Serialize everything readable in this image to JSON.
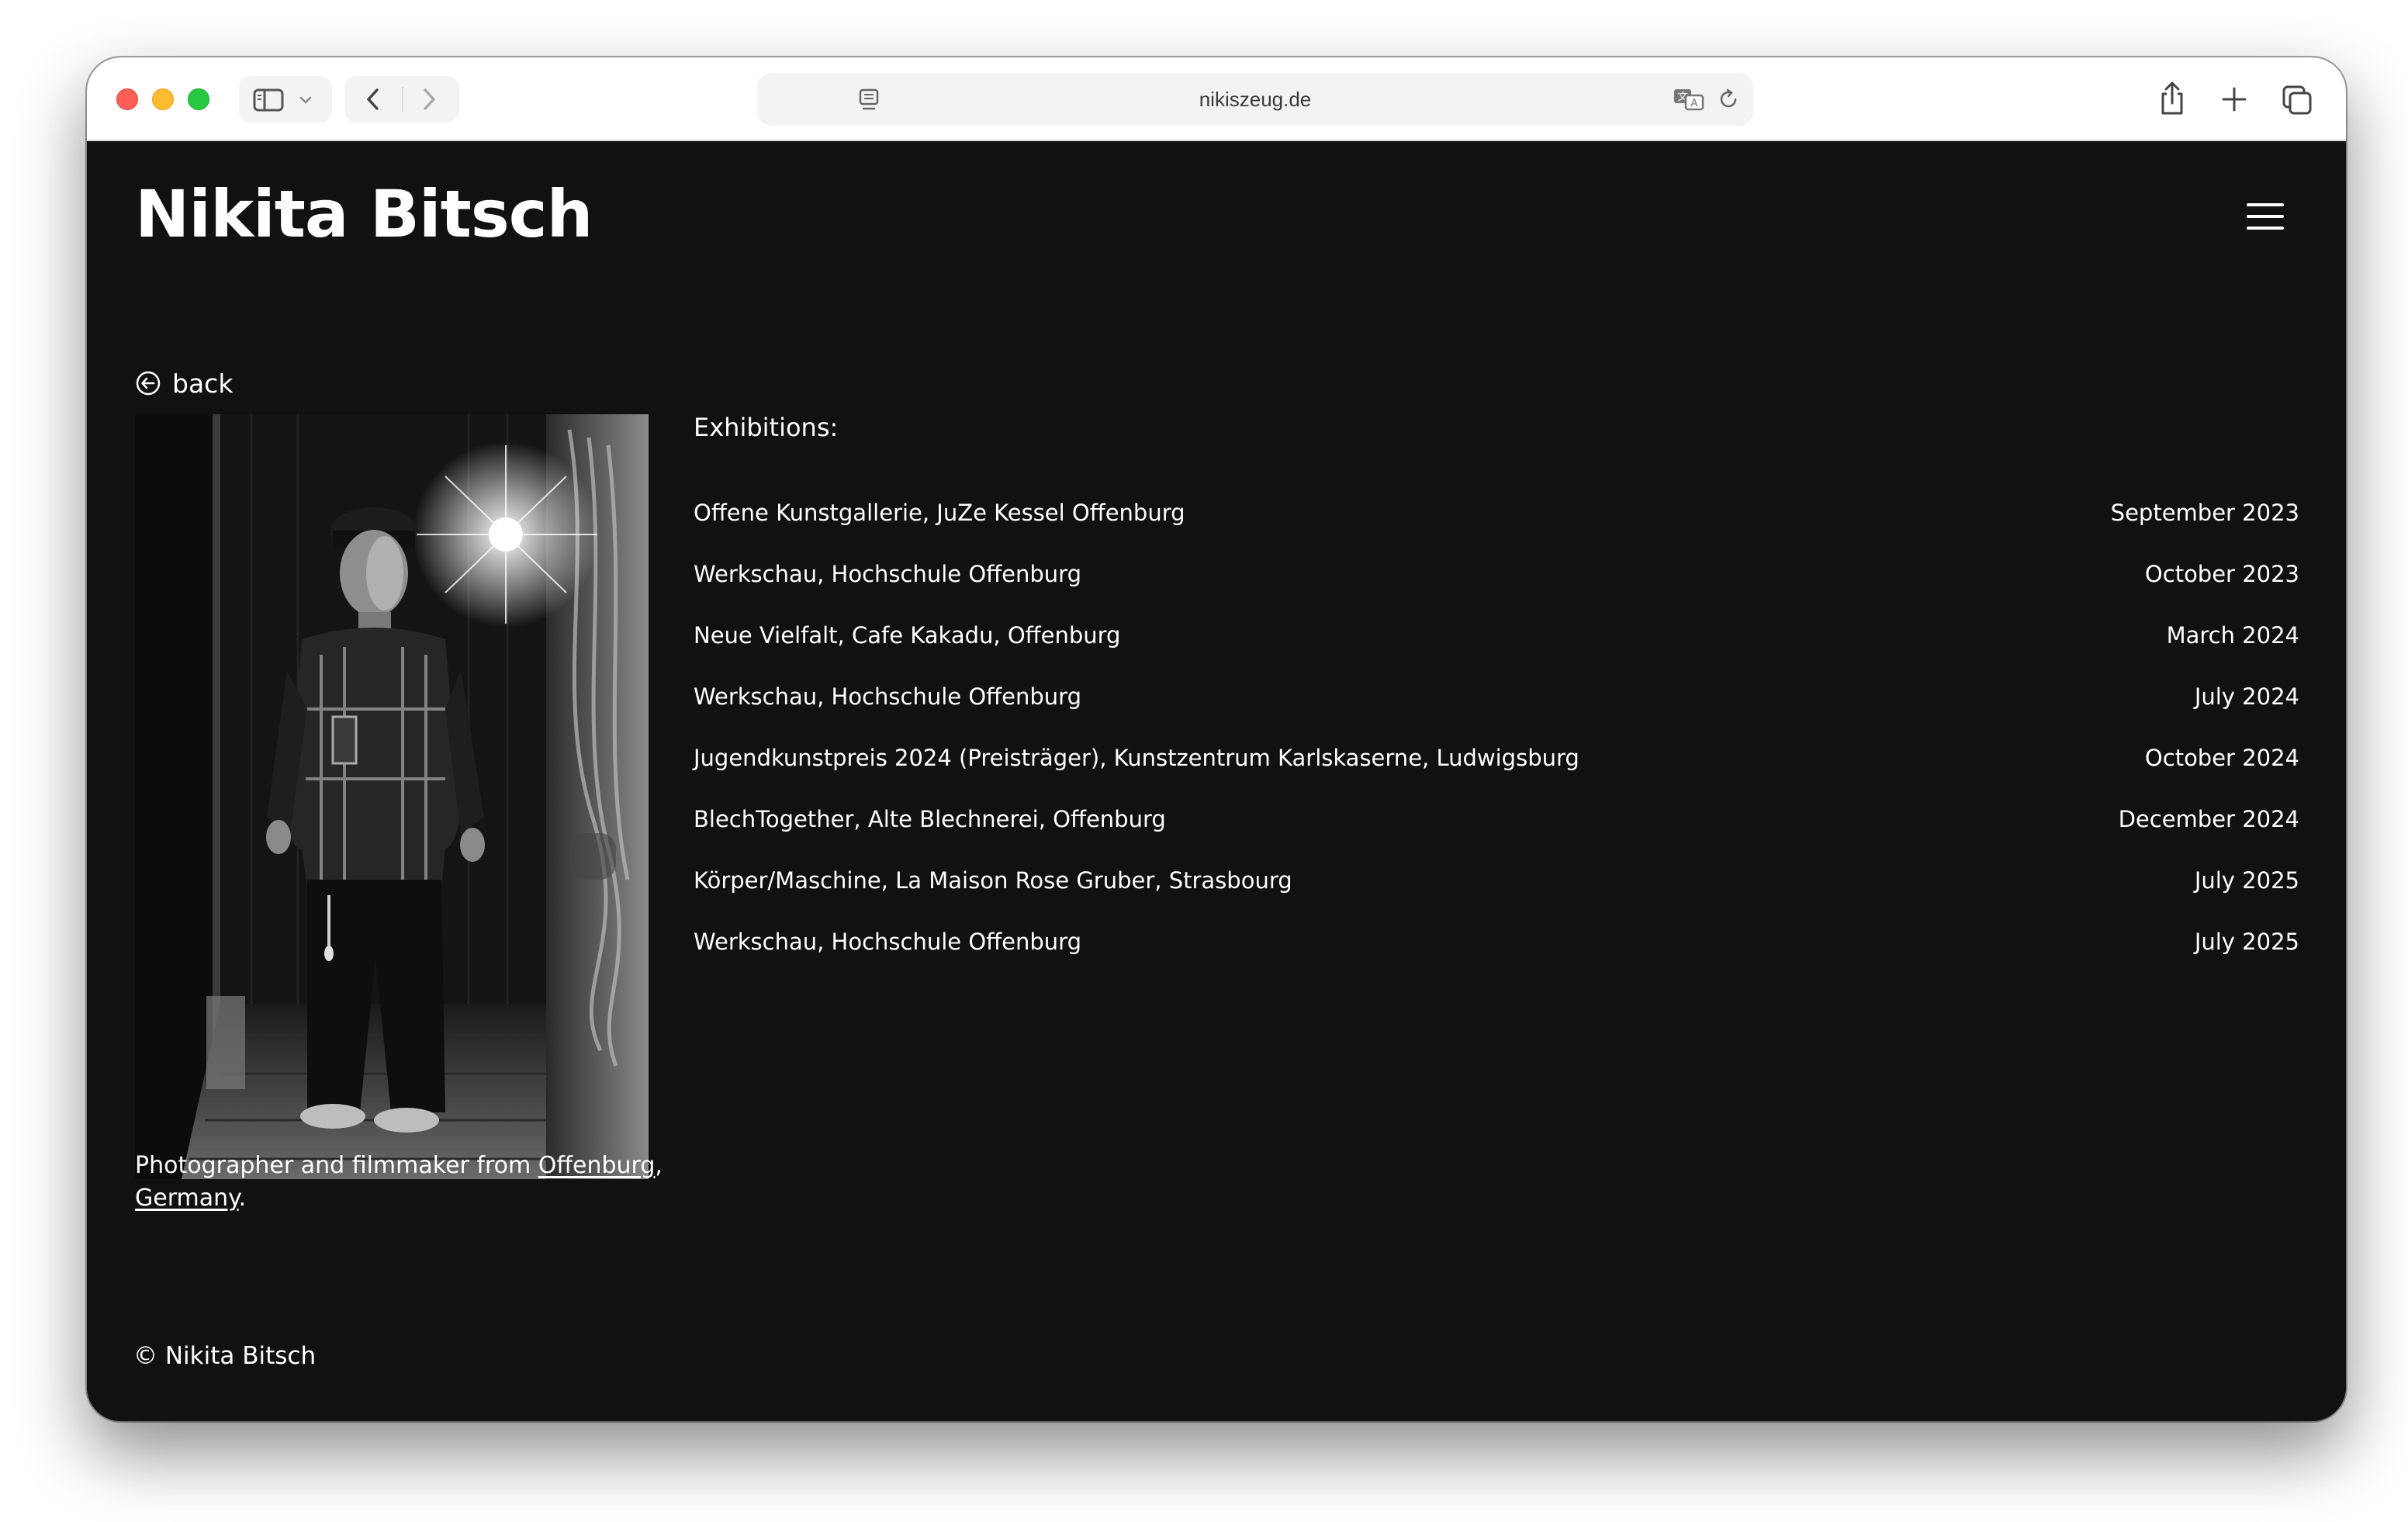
{
  "browser": {
    "url": "nikiszeug.de",
    "icons": [
      "sidebar-icon",
      "chevron-down-icon",
      "back-arrow-icon",
      "forward-arrow-icon",
      "page-icon",
      "translate-icon",
      "reload-icon",
      "share-icon",
      "plus-icon",
      "tabs-icon"
    ]
  },
  "site": {
    "title": "Nikita Bitsch",
    "menu_icon": "hamburger-menu-icon"
  },
  "back": {
    "label": "back",
    "icon": "circle-arrow-left-icon"
  },
  "exhibitions": {
    "heading": "Exhibitions:",
    "items": [
      {
        "name": "Offene Kunstgallerie, JuZe Kessel Offenburg",
        "date": "September 2023"
      },
      {
        "name": "Werkschau, Hochschule Offenburg",
        "date": "October 2023"
      },
      {
        "name": "Neue Vielfalt, Cafe Kakadu, Offenburg",
        "date": "March 2024"
      },
      {
        "name": "Werkschau, Hochschule Offenburg",
        "date": "July 2024"
      },
      {
        "name": "Jugendkunstpreis 2024 (Preisträger), Kunstzentrum Karlskaserne, Ludwigsburg",
        "date": "October 2024"
      },
      {
        "name": "BlechTogether, Alte Blechnerei, Offenburg",
        "date": "December 2024"
      },
      {
        "name": "Körper/Maschine, La Maison Rose Gruber, Strasbourg",
        "date": "July 2025"
      },
      {
        "name": "Werkschau, Hochschule Offenburg",
        "date": "July 2025"
      }
    ]
  },
  "bio": {
    "prefix": "Photographer and filmmaker from ",
    "link1": "Offenburg",
    "sep": ",",
    "link2": "Germany",
    "suffix": "."
  },
  "footer": {
    "copyright": "© Nikita Bitsch"
  },
  "colors": {
    "page_background": "#111111",
    "text": "#ffffff",
    "toolbar_background": "#ffffff"
  }
}
